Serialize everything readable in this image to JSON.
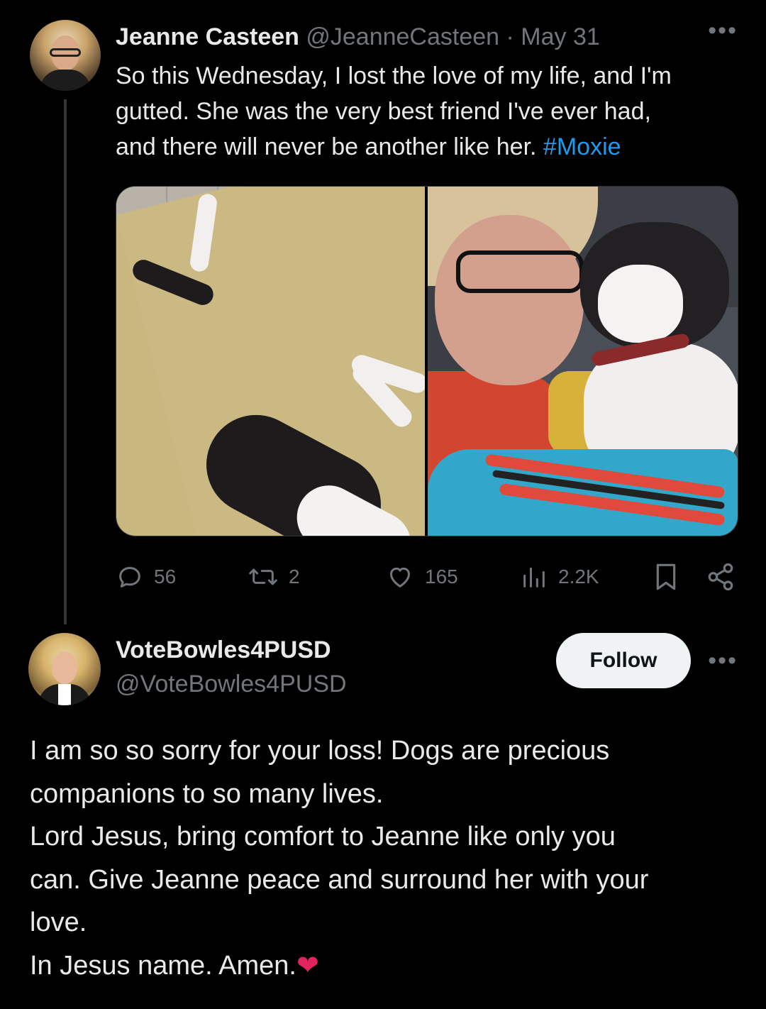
{
  "original_tweet": {
    "author_name": "Jeanne Casteen",
    "handle": "@JeanneCasteen",
    "separator": "·",
    "date": "May 31",
    "text_lines": [
      "So this Wednesday, I lost the love of my life, and I'm",
      "gutted. She was the very best friend I've ever had,",
      "and there will never be another like her. "
    ],
    "hashtag": "#Moxie",
    "stats": {
      "replies": "56",
      "retweets": "2",
      "likes": "165",
      "views": "2.2K"
    },
    "icons": [
      "reply-icon",
      "retweet-icon",
      "like-icon",
      "views-icon",
      "bookmark-icon",
      "share-icon",
      "more-icon"
    ]
  },
  "reply": {
    "author_name": "VoteBowles4PUSD",
    "handle": "@VoteBowles4PUSD",
    "follow_label": "Follow",
    "text_lines": [
      "I am so so sorry for your loss! Dogs are precious",
      "companions to so many lives.",
      "Lord Jesus, bring comfort to Jeanne like only you",
      "can. Give Jeanne peace and surround her with your",
      "love.",
      "In Jesus name. Amen."
    ],
    "heart_emoji": "❤"
  },
  "colors": {
    "background": "#000000",
    "text": "#e7e9ea",
    "muted": "#71767b",
    "link": "#1d9bf0",
    "follow_bg": "#eff3f4",
    "heart": "#e0245e"
  }
}
